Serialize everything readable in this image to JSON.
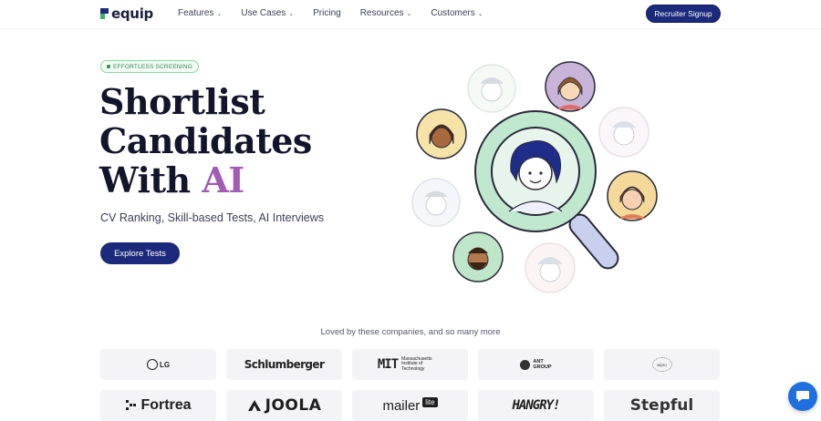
{
  "nav": {
    "logo_text": "equip",
    "menu": [
      {
        "label": "Features",
        "has_dropdown": true
      },
      {
        "label": "Use Cases",
        "has_dropdown": true
      },
      {
        "label": "Pricing",
        "has_dropdown": false
      },
      {
        "label": "Resources",
        "has_dropdown": true
      },
      {
        "label": "Customers",
        "has_dropdown": true
      }
    ],
    "cta": "Recruiter Signup"
  },
  "hero": {
    "badge": "EFFORTLESS SCREENING",
    "headline_line1": "Shortlist",
    "headline_line2": "Candidates",
    "headline_line3_prefix": "With ",
    "headline_accent": "AI",
    "subtitle": "CV Ranking, Skill-based Tests, AI Interviews",
    "button": "Explore Tests",
    "accent_color": "#a35bb5",
    "brand_color": "#1b2a7a"
  },
  "logos": {
    "caption": "Loved by these companies, and so many more",
    "items": [
      {
        "name": "LG",
        "text": "LG"
      },
      {
        "name": "Schlumberger",
        "text": "Schlumberger"
      },
      {
        "name": "MIT",
        "text": "MIT",
        "sub": "Massachusetts Institute of Technology"
      },
      {
        "name": "Ant Group",
        "text": "ANT",
        "sub": "GROUP"
      },
      {
        "name": "Wipro",
        "text": "wipro"
      },
      {
        "name": "Fortrea",
        "text": "Fortrea"
      },
      {
        "name": "Joola",
        "text": "JOOLA"
      },
      {
        "name": "MailerLite",
        "text": "mailer",
        "sub": "lite"
      },
      {
        "name": "Hangry",
        "text": "HANGRY!"
      },
      {
        "name": "Stepful",
        "text": "Stepful"
      }
    ]
  },
  "icons": {
    "chevron": "chevron-down-icon",
    "chat": "chat-bubble-icon"
  }
}
